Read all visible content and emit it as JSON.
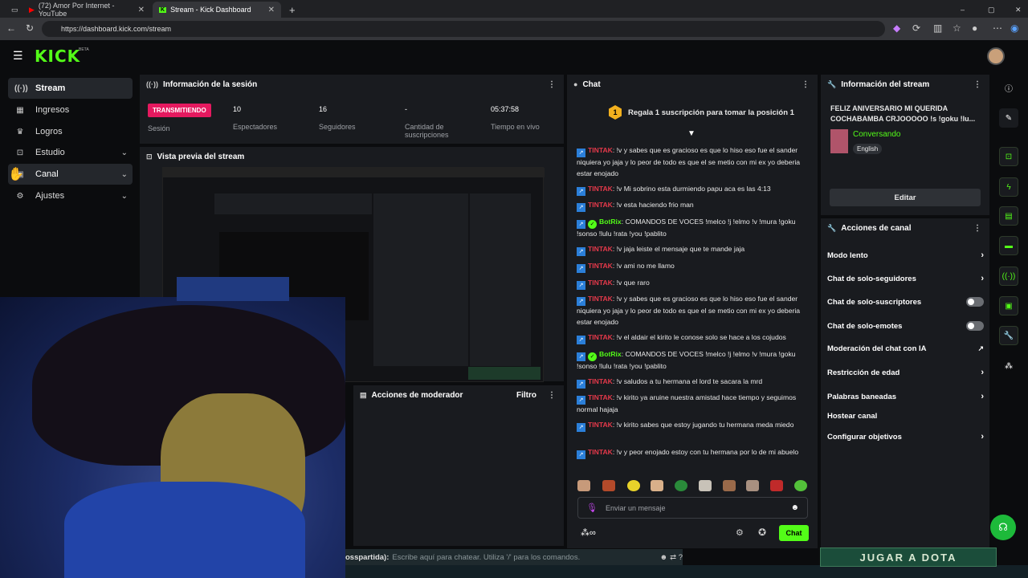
{
  "browser": {
    "tabs": [
      {
        "label": "(72) Amor Por Internet - YouTube"
      },
      {
        "label": "Stream - Kick Dashboard"
      }
    ],
    "url": "https://dashboard.kick.com/stream"
  },
  "app": {
    "logo": "KICK",
    "beta": "BETA"
  },
  "sidebar": {
    "items": [
      {
        "label": "Stream",
        "icon": "broadcast-icon"
      },
      {
        "label": "Ingresos",
        "icon": "chart-icon"
      },
      {
        "label": "Logros",
        "icon": "trophy-icon"
      },
      {
        "label": "Estudio",
        "icon": "studio-icon"
      },
      {
        "label": "Canal",
        "icon": "user-icon"
      },
      {
        "label": "Ajustes",
        "icon": "gear-icon"
      }
    ]
  },
  "session": {
    "title": "Información de la sesión",
    "status": "TRANSMITIENDO",
    "status_label": "Sesión",
    "stats": [
      {
        "value": "10",
        "label": "Espectadores"
      },
      {
        "value": "16",
        "label": "Seguidores"
      },
      {
        "value": "-",
        "label": "Cantidad de suscripciones"
      },
      {
        "value": "05:37:58",
        "label": "Tiempo en vivo"
      }
    ]
  },
  "preview": {
    "title": "Vista previa del stream"
  },
  "mod": {
    "title": "Acciones de moderador",
    "filter": "Filtro"
  },
  "chat": {
    "title": "Chat",
    "gift": "Regala 1 suscripción para tomar la posición 1",
    "gift_rank": "1",
    "messages": [
      {
        "user": "TINTAK",
        "type": "t",
        "text": "!v y sabes que es gracioso es que lo hiso eso fue el sander niquiera yo jaja y lo peor de todo es que el se metio con mi ex yo deberia estar enojado"
      },
      {
        "user": "TINTAK",
        "type": "t",
        "text": "!v Mi sobrino esta durmiendo papu aca es las 4:13"
      },
      {
        "user": "TINTAK",
        "type": "t",
        "text": "!v esta haciendo frio man"
      },
      {
        "user": "BotRix",
        "type": "b",
        "text": "COMANDOS DE VOCES !melco !j !elmo !v !mura !goku !sonso !lulu !rata !you !pablito"
      },
      {
        "user": "TINTAK",
        "type": "t",
        "text": "!v jaja leiste el mensaje que te mande jaja"
      },
      {
        "user": "TINTAK",
        "type": "t",
        "text": "!v ami no me llamo"
      },
      {
        "user": "TINTAK",
        "type": "t",
        "text": "!v que raro"
      },
      {
        "user": "TINTAK",
        "type": "t",
        "text": "!v y sabes que es gracioso es que lo hiso eso fue el sander niquiera yo jaja y lo peor de todo es que el se metio con mi ex yo deberia estar enojado"
      },
      {
        "user": "TINTAK",
        "type": "t",
        "text": "!v el aldair el kirito le conose solo se hace a los cojudos"
      },
      {
        "user": "BotRix",
        "type": "b",
        "text": "COMANDOS DE VOCES !melco !j !elmo !v !mura !goku !sonso !lulu !rata !you !pablito"
      },
      {
        "user": "TINTAK",
        "type": "t",
        "text": "!v saludos a tu hermana el lord te sacara la mrd"
      },
      {
        "user": "TINTAK",
        "type": "t",
        "text": "!v kirito ya aruine nuestra amistad hace tiempo y seguimos normal hajaja"
      },
      {
        "user": "TINTAK",
        "type": "t",
        "text": "!v kirito sabes que estoy jugando tu hermana meda miedo"
      },
      {
        "user": "TINTAK",
        "type": "t",
        "text": "!v y peor enojado estoy con tu hermana por lo de mi abuelo"
      }
    ],
    "input_placeholder": "Enviar un mensaje",
    "send": "Chat"
  },
  "stream_info": {
    "title": "Información del stream",
    "stream_title": "FELIZ ANIVERSARIO MI QUERIDA COCHABAMBA CRJOOOOO !s !goku !lu...",
    "category": "Conversando",
    "language": "English",
    "edit": "Editar"
  },
  "channel_actions": {
    "title": "Acciones de canal",
    "items": [
      {
        "label": "Modo lento",
        "kind": "chevron"
      },
      {
        "label": "Chat de solo-seguidores",
        "kind": "chevron"
      },
      {
        "label": "Chat de solo-suscriptores",
        "kind": "toggle"
      },
      {
        "label": "Chat de solo-emotes",
        "kind": "toggle"
      },
      {
        "label": "Moderación del chat con IA",
        "kind": "external"
      },
      {
        "label": "Restricción de edad",
        "kind": "chevron"
      },
      {
        "label": "Palabras baneadas",
        "kind": "chevron"
      },
      {
        "label": "Hostear canal",
        "kind": "none"
      },
      {
        "label": "Configurar objetivos",
        "kind": "chevron"
      }
    ]
  },
  "overlay": {
    "game_chat_user": "osspartida):",
    "game_chat_placeholder": "Escribe aquí para chatear. Utiliza '/' para los comandos.",
    "banner": "JUGAR A DOTA"
  },
  "colors": {
    "kick_green": "#53fc18",
    "live_pink": "#e5195f",
    "tintak_red": "#e5394a",
    "panel": "#191b1f"
  }
}
